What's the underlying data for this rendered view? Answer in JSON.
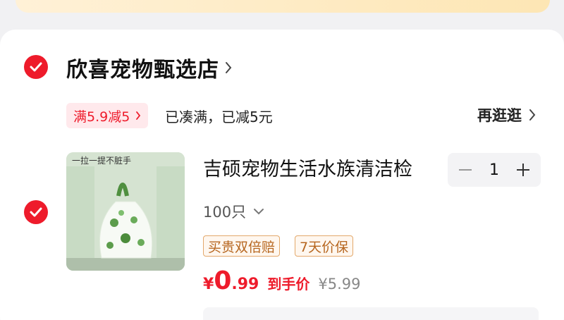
{
  "shop": {
    "name": "欣喜宠物甄选店",
    "checked": true
  },
  "promo": {
    "tag": "满5.9减5",
    "status": "已凑满，已减5元",
    "browse_more": "再逛逛"
  },
  "product": {
    "title": "吉硕宠物生活水族清洁检",
    "variant": "100只",
    "quantity": "1",
    "badges": [
      "买贵双倍赔",
      "7天价保"
    ],
    "price": {
      "currency": "¥",
      "integer": "0",
      "decimal": ".99",
      "label": "到手价"
    },
    "original_price": "¥5.99",
    "image_caption": "一拉一提不脏手",
    "checked": true
  },
  "colors": {
    "accent_red": "#ee1b2b",
    "badge_border": "#e3a86b",
    "banner": "#fde6b4"
  }
}
